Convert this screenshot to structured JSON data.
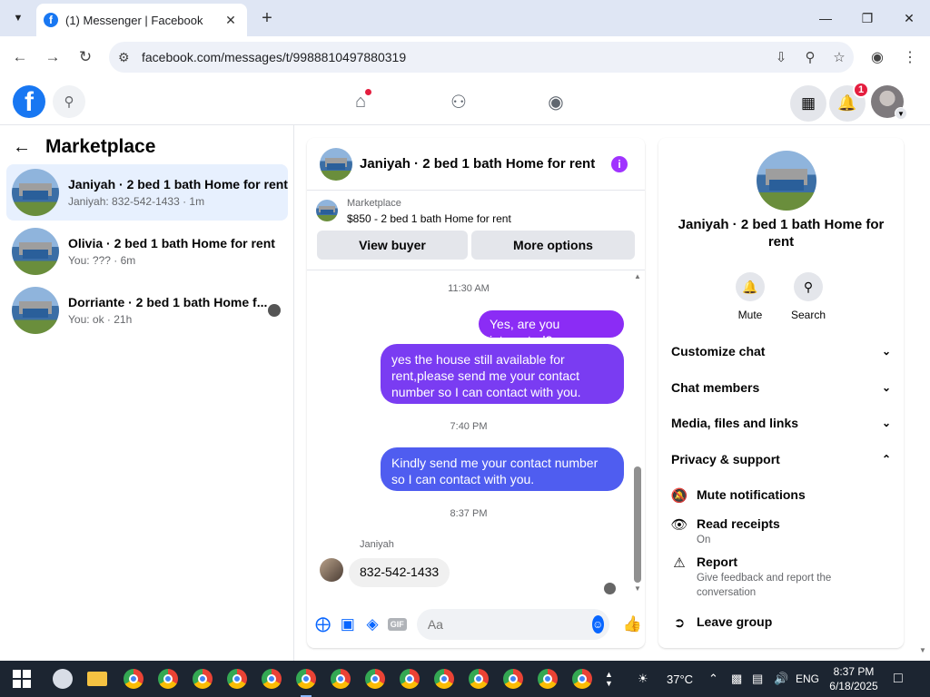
{
  "browser": {
    "tab_title": "(1) Messenger | Facebook",
    "tab_favicon": "f",
    "url": "facebook.com/messages/t/9988810497880319",
    "icons": [
      "tab-search-icon",
      "close-icon",
      "new-tab-icon",
      "minimize-icon",
      "maximize-icon",
      "window-close-icon",
      "back-icon",
      "forward-icon",
      "reload-icon",
      "site-info-icon",
      "install-icon",
      "zoom-icon",
      "bookmark-star-icon",
      "profile-icon",
      "menu-icon"
    ]
  },
  "fb": {
    "notif_count": "1",
    "brand_color": "#1877f2"
  },
  "sidebar": {
    "title": "Marketplace",
    "conversations": [
      {
        "name": "Janiyah · 2 bed 1 bath Home for rent",
        "preview": "Janiyah: 832-542-1433 · 1m"
      },
      {
        "name": "Olivia · 2 bed 1 bath Home for rent",
        "preview": "You: ??? · 6m"
      },
      {
        "name": "Dorriante · 2 bed 1 bath Home f...",
        "preview": "You: ok · 21h"
      }
    ]
  },
  "chat": {
    "title": "Janiyah · 2 bed 1 bath Home for rent",
    "listing_source": "Marketplace",
    "listing_price": "$850 - 2 bed 1 bath Home for rent",
    "view_buyer": "View buyer",
    "more_options": "More options",
    "time1": "11:30 AM",
    "msg1": "Yes, are you interested?",
    "msg2": "yes the house still available for rent,please send me your contact number so I can contact with you.",
    "time2": "7:40 PM",
    "msg3": "Kindly  send me your contact number so I can contact with you.",
    "time3": "8:37 PM",
    "sender": "Janiyah",
    "incoming": "832-542-1433",
    "composer_placeholder": "Aa",
    "gif_label": "GIF"
  },
  "panel": {
    "name": "Janiyah · 2 bed 1 bath Home for rent",
    "mute": "Mute",
    "search": "Search",
    "customize": "Customize chat",
    "members": "Chat members",
    "media": "Media, files and links",
    "privacy": "Privacy & support",
    "mute_notifications": "Mute notifications",
    "read_receipts": "Read receipts",
    "read_receipts_state": "On",
    "report": "Report",
    "report_sub": "Give feedback and report the conversation",
    "leave": "Leave group"
  },
  "taskbar": {
    "temperature": "37°C",
    "language": "ENG",
    "time": "8:37 PM",
    "date": "6/18/2025"
  }
}
